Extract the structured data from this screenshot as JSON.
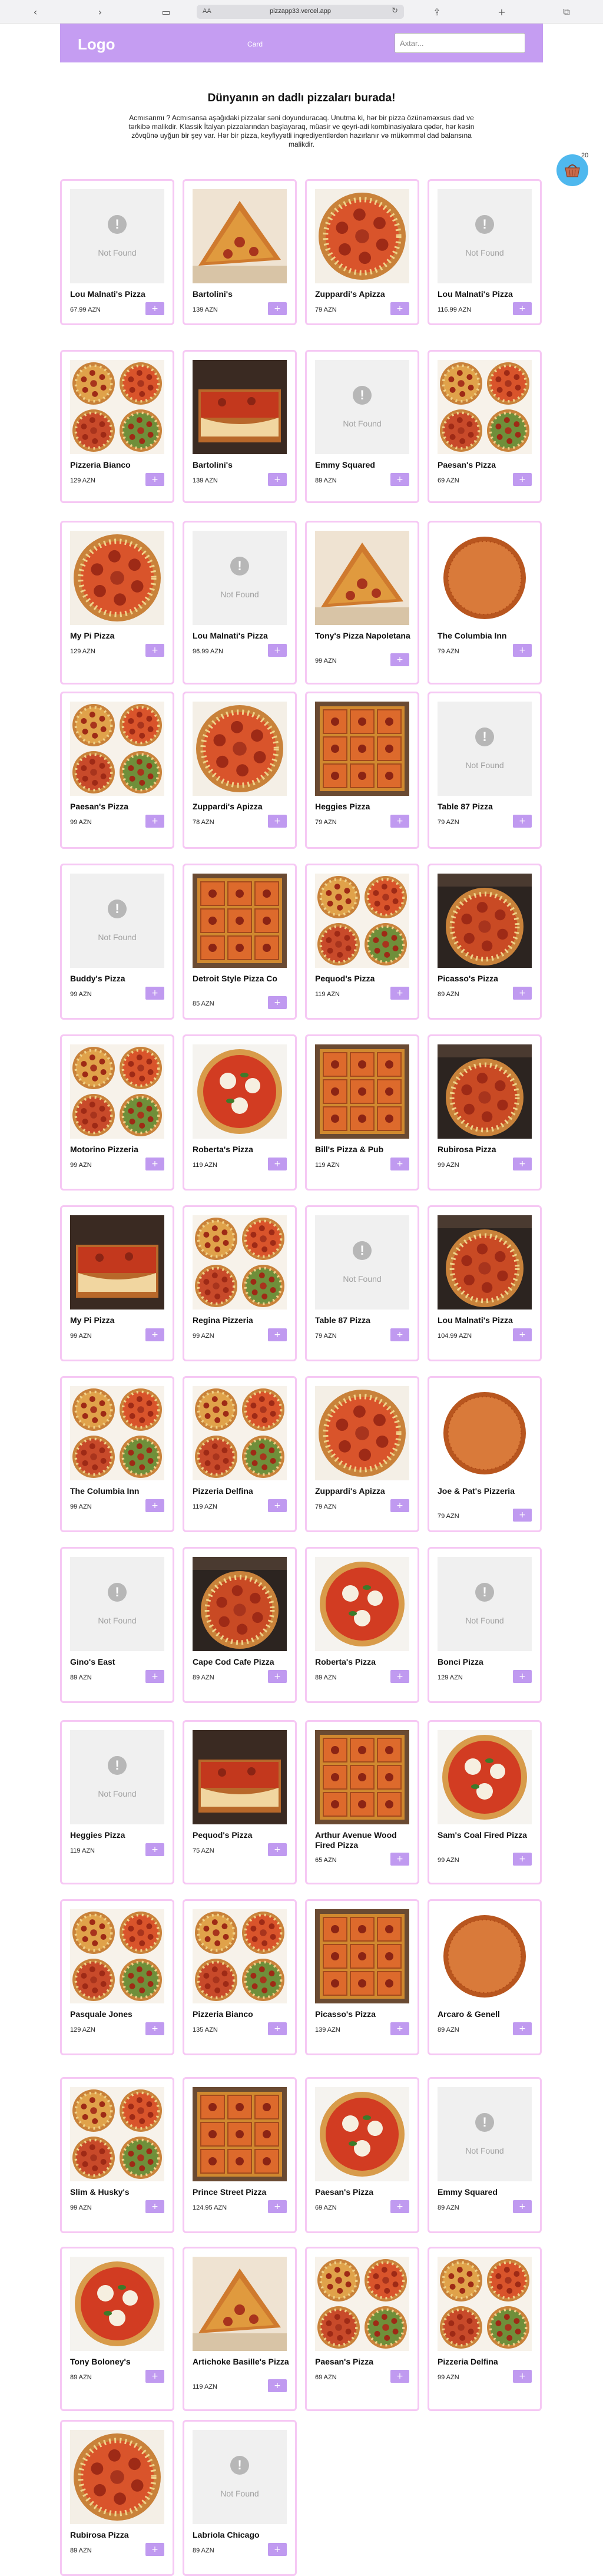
{
  "browser": {
    "text_size": "AA",
    "url": "pizzapp33.vercel.app"
  },
  "header": {
    "logo": "Logo",
    "cart_label": "Card",
    "search_placeholder": "Axtar..."
  },
  "hero": {
    "title": "Dünyanın ən dadlı pizzaları burada!",
    "text": "Acmısanmı ? Acmısansa aşağıdaki pizzalar səni doyunduracaq. Unutma ki, hər bir pizza özünəməxsus dad ve tərkibə malikdir. Klassik İtalyan pizzalarından başlayaraq, müasir ve qeyri-adi kombinasiyalara qədər, hər kəsin zövqünə uyğun bir şey var. Hər bir pizza, keyfiyyətli inqrediyentlərdən hazırlanır və mükəmməl dad balansına malikdir."
  },
  "cart": {
    "count": "20",
    "icon": "basket-icon"
  },
  "add_label": "+",
  "not_found_label": "Not Found",
  "colors": {
    "accent": "#c59df2",
    "button": "#c09af0",
    "card_border": "#f6c8f4",
    "cart_bubble": "#4fb8ee"
  },
  "products": [
    {
      "name": "Lou Malnati's Pizza",
      "price": "67.99 AZN",
      "img": "nf"
    },
    {
      "name": "Bartolini's",
      "price": "139 AZN",
      "img": "slice"
    },
    {
      "name": "Zuppardi's Apizza",
      "price": "79 AZN",
      "img": "pep"
    },
    {
      "name": "Lou Malnati's Pizza",
      "price": "116.99 AZN",
      "img": "nf"
    },
    {
      "name": "Pizzeria Bianco",
      "price": "129 AZN",
      "img": "quad"
    },
    {
      "name": "Bartolini's",
      "price": "139 AZN",
      "img": "deep"
    },
    {
      "name": "Emmy Squared",
      "price": "89 AZN",
      "img": "nf"
    },
    {
      "name": "Paesan's Pizza",
      "price": "69 AZN",
      "img": "quad"
    },
    {
      "name": "My Pi Pizza",
      "price": "129 AZN",
      "img": "pep"
    },
    {
      "name": "Lou Malnati's Pizza",
      "price": "96.99 AZN",
      "img": "nf"
    },
    {
      "name": "Tony's Pizza Napoletana",
      "price": "99 AZN",
      "img": "slice"
    },
    {
      "name": "The Columbia Inn",
      "price": "79 AZN",
      "img": "thin"
    },
    {
      "name": "Paesan's Pizza",
      "price": "99 AZN",
      "img": "quad"
    },
    {
      "name": "Zuppardi's Apizza",
      "price": "78 AZN",
      "img": "pep"
    },
    {
      "name": "Heggies Pizza",
      "price": "79 AZN",
      "img": "square"
    },
    {
      "name": "Table 87 Pizza",
      "price": "79 AZN",
      "img": "nf"
    },
    {
      "name": "Buddy's Pizza",
      "price": "99 AZN",
      "img": "nf"
    },
    {
      "name": "Detroit Style Pizza Co",
      "price": "85 AZN",
      "img": "square"
    },
    {
      "name": "Pequod's Pizza",
      "price": "119 AZN",
      "img": "quad"
    },
    {
      "name": "Picasso's Pizza",
      "price": "89 AZN",
      "img": "dark"
    },
    {
      "name": "Motorino Pizzeria",
      "price": "99 AZN",
      "img": "quad"
    },
    {
      "name": "Roberta's Pizza",
      "price": "119 AZN",
      "img": "marg"
    },
    {
      "name": "Bill's Pizza & Pub",
      "price": "119 AZN",
      "img": "square"
    },
    {
      "name": "Rubirosa Pizza",
      "price": "99 AZN",
      "img": "dark"
    },
    {
      "name": "My Pi Pizza",
      "price": "99 AZN",
      "img": "deep"
    },
    {
      "name": "Regina Pizzeria",
      "price": "99 AZN",
      "img": "quad"
    },
    {
      "name": "Table 87 Pizza",
      "price": "79 AZN",
      "img": "nf"
    },
    {
      "name": "Lou Malnati's Pizza",
      "price": "104.99 AZN",
      "img": "dark"
    },
    {
      "name": "The Columbia Inn",
      "price": "99 AZN",
      "img": "quad"
    },
    {
      "name": "Pizzeria Delfina",
      "price": "119 AZN",
      "img": "quad"
    },
    {
      "name": "Zuppardi's Apizza",
      "price": "79 AZN",
      "img": "pep"
    },
    {
      "name": "Joe & Pat's Pizzeria",
      "price": "79 AZN",
      "img": "thin"
    },
    {
      "name": "Gino's East",
      "price": "89 AZN",
      "img": "nf"
    },
    {
      "name": "Cape Cod Cafe Pizza",
      "price": "89 AZN",
      "img": "dark"
    },
    {
      "name": "Roberta's Pizza",
      "price": "89 AZN",
      "img": "marg"
    },
    {
      "name": "Bonci Pizza",
      "price": "129 AZN",
      "img": "nf"
    },
    {
      "name": "Heggies Pizza",
      "price": "119 AZN",
      "img": "nf"
    },
    {
      "name": "Pequod's Pizza",
      "price": "75 AZN",
      "img": "deep"
    },
    {
      "name": "Arthur Avenue Wood Fired Pizza",
      "price": "65 AZN",
      "img": "square"
    },
    {
      "name": "Sam's Coal Fired Pizza",
      "price": "99 AZN",
      "img": "marg"
    },
    {
      "name": "Pasquale Jones",
      "price": "129 AZN",
      "img": "quad"
    },
    {
      "name": "Pizzeria Bianco",
      "price": "135 AZN",
      "img": "quad"
    },
    {
      "name": "Picasso's Pizza",
      "price": "139 AZN",
      "img": "square"
    },
    {
      "name": "Arcaro & Genell",
      "price": "89 AZN",
      "img": "thin"
    },
    {
      "name": "Slim & Husky's",
      "price": "99 AZN",
      "img": "quad"
    },
    {
      "name": "Prince Street Pizza",
      "price": "124.95 AZN",
      "img": "square"
    },
    {
      "name": "Paesan's Pizza",
      "price": "69 AZN",
      "img": "marg"
    },
    {
      "name": "Emmy Squared",
      "price": "89 AZN",
      "img": "nf"
    },
    {
      "name": "Tony Boloney's",
      "price": "89 AZN",
      "img": "marg"
    },
    {
      "name": "Artichoke Basille's Pizza",
      "price": "119 AZN",
      "img": "slice"
    },
    {
      "name": "Paesan's Pizza",
      "price": "69 AZN",
      "img": "quad"
    },
    {
      "name": "Pizzeria Delfina",
      "price": "99 AZN",
      "img": "quad"
    },
    {
      "name": "Rubirosa Pizza",
      "price": "89 AZN",
      "img": "pep"
    },
    {
      "name": "Labriola Chicago",
      "price": "89 AZN",
      "img": "nf"
    }
  ]
}
